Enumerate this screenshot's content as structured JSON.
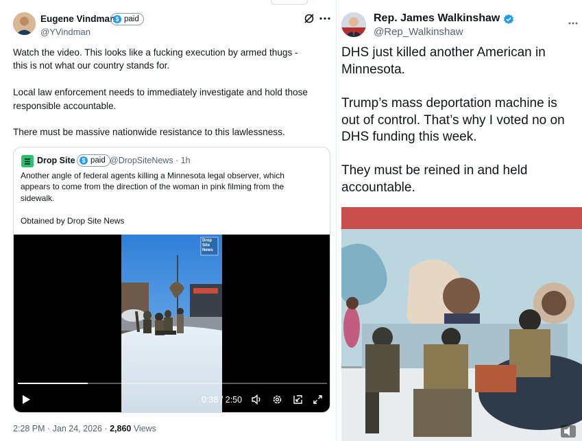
{
  "left_tweet": {
    "author": {
      "name": "Eugene Vindman",
      "handle": "@YVindman",
      "badge_label": "paid"
    },
    "body": "Watch the video. This looks like a fucking execution by armed thugs -\nthis is not what our country stands for.\n\nLocal law enforcement needs to immediately investigate and hold those\nresponsible accountable.\n\nThere must be massive nationwide resistance to this lawlessness.",
    "quote": {
      "author_name": "Drop Site",
      "badge_label": "paid",
      "handle_time": "@DropSiteNews · 1h",
      "text": "Another angle of federal agents killing a Minnesota legal observer, which\nappears to come from the direction of the woman in pink filming from the\nsidewalk.",
      "credit": "Obtained by Drop Site News",
      "video": {
        "watermark": "Drop\nSite\nNews",
        "time_display": "0:38 / 2:50",
        "progress_fraction": 0.226
      }
    },
    "meta": {
      "timestamp": "2:28 PM · Jan 24, 2026 · ",
      "views_count": "2,860",
      "views_label": " Views"
    }
  },
  "right_tweet": {
    "author": {
      "name": "Rep. James Walkinshaw",
      "handle": "@Rep_Walkinshaw",
      "verified": true
    },
    "paragraphs": [
      "DHS just killed another American in\nMinnesota.",
      "Trump’s mass deportation machine is\nout of control. That’s why I voted no on\nDHS funding this week.",
      "They must be reined in and held\naccountable."
    ]
  },
  "colors": {
    "accent": "#1d9bf0",
    "muted": "#536471",
    "border": "#cfd9de",
    "drop_site_green": "#2fbf71"
  }
}
